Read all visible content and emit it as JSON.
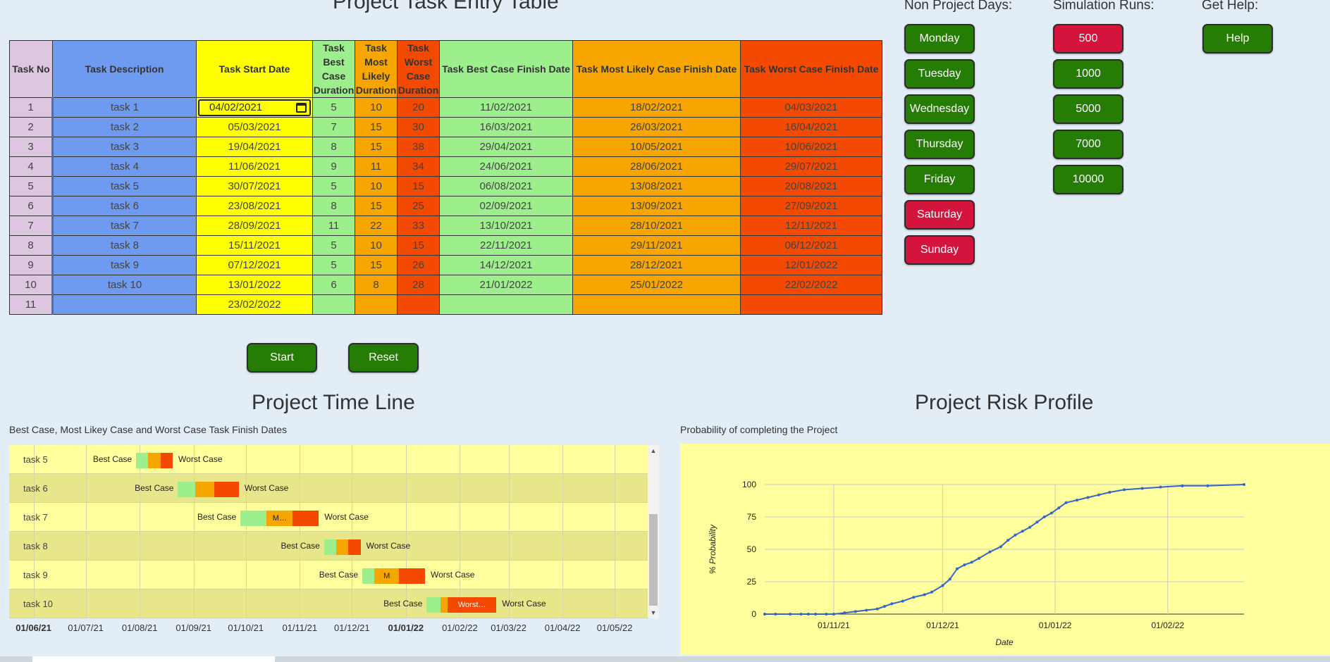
{
  "headings": {
    "entry_table": "Project Task Entry Table",
    "non_project_days": "Non Project Days:",
    "simulation_runs": "Simulation Runs:",
    "get_help": "Get Help:",
    "timeline": "Project Time Line",
    "risk": "Project Risk Profile"
  },
  "table": {
    "headers": {
      "no": "Task No",
      "desc": "Task Description",
      "start": "Task Start Date",
      "best": "Task Best Case Duration",
      "ml": "Task Most Likely Duration",
      "worst": "Task Worst Case Duration",
      "best_finish": "Task Best Case Finish Date",
      "ml_finish": "Task Most Likely Case Finish Date",
      "worst_finish": "Task Worst Case Finish Date"
    },
    "rows": [
      {
        "no": "1",
        "desc": "task 1",
        "start": "04/02/2021",
        "best": "5",
        "ml": "10",
        "worst": "20",
        "best_finish": "11/02/2021",
        "ml_finish": "18/02/2021",
        "worst_finish": "04/03/2021"
      },
      {
        "no": "2",
        "desc": "task 2",
        "start": "05/03/2021",
        "best": "7",
        "ml": "15",
        "worst": "30",
        "best_finish": "16/03/2021",
        "ml_finish": "26/03/2021",
        "worst_finish": "16/04/2021"
      },
      {
        "no": "3",
        "desc": "task 3",
        "start": "19/04/2021",
        "best": "8",
        "ml": "15",
        "worst": "38",
        "best_finish": "29/04/2021",
        "ml_finish": "10/05/2021",
        "worst_finish": "10/06/2021"
      },
      {
        "no": "4",
        "desc": "task 4",
        "start": "11/06/2021",
        "best": "9",
        "ml": "11",
        "worst": "34",
        "best_finish": "24/06/2021",
        "ml_finish": "28/06/2021",
        "worst_finish": "29/07/2021"
      },
      {
        "no": "5",
        "desc": "task 5",
        "start": "30/07/2021",
        "best": "5",
        "ml": "10",
        "worst": "15",
        "best_finish": "06/08/2021",
        "ml_finish": "13/08/2021",
        "worst_finish": "20/08/2021"
      },
      {
        "no": "6",
        "desc": "task 6",
        "start": "23/08/2021",
        "best": "8",
        "ml": "15",
        "worst": "25",
        "best_finish": "02/09/2021",
        "ml_finish": "13/09/2021",
        "worst_finish": "27/09/2021"
      },
      {
        "no": "7",
        "desc": "task 7",
        "start": "28/09/2021",
        "best": "11",
        "ml": "22",
        "worst": "33",
        "best_finish": "13/10/2021",
        "ml_finish": "28/10/2021",
        "worst_finish": "12/11/2021"
      },
      {
        "no": "8",
        "desc": "task 8",
        "start": "15/11/2021",
        "best": "5",
        "ml": "10",
        "worst": "15",
        "best_finish": "22/11/2021",
        "ml_finish": "29/11/2021",
        "worst_finish": "06/12/2021"
      },
      {
        "no": "9",
        "desc": "task 9",
        "start": "07/12/2021",
        "best": "5",
        "ml": "15",
        "worst": "26",
        "best_finish": "14/12/2021",
        "ml_finish": "28/12/2021",
        "worst_finish": "12/01/2022"
      },
      {
        "no": "10",
        "desc": "task 10",
        "start": "13/01/2022",
        "best": "6",
        "ml": "8",
        "worst": "28",
        "best_finish": "21/01/2022",
        "ml_finish": "25/01/2022",
        "worst_finish": "22/02/2022"
      },
      {
        "no": "11",
        "desc": "",
        "start": "23/02/2022",
        "best": "",
        "ml": "",
        "worst": "",
        "best_finish": "",
        "ml_finish": "",
        "worst_finish": ""
      }
    ]
  },
  "buttons": {
    "days": [
      {
        "label": "Monday",
        "selected": true
      },
      {
        "label": "Tuesday",
        "selected": true
      },
      {
        "label": "Wednesday",
        "selected": true
      },
      {
        "label": "Thursday",
        "selected": true
      },
      {
        "label": "Friday",
        "selected": true
      },
      {
        "label": "Saturday",
        "selected": false
      },
      {
        "label": "Sunday",
        "selected": false
      }
    ],
    "runs": [
      {
        "label": "500",
        "selected": false
      },
      {
        "label": "1000",
        "selected": true
      },
      {
        "label": "5000",
        "selected": true
      },
      {
        "label": "7000",
        "selected": true
      },
      {
        "label": "10000",
        "selected": true
      }
    ],
    "help": "Help",
    "start": "Start",
    "reset": "Reset"
  },
  "colors": {
    "selected": "#267d05",
    "unselected": "#d4143c",
    "best": "#9cef8c",
    "most_likely": "#f7a500",
    "worst": "#f44900"
  },
  "timeline": {
    "subtitle": "Best Case, Most Likey Case and Worst Case Task Finish Dates",
    "best_label": "Best Case",
    "worst_label": "Worst Case",
    "rows": [
      {
        "label": "task 5",
        "ml_text": "",
        "worst_text": ""
      },
      {
        "label": "task 6",
        "ml_text": "",
        "worst_text": ""
      },
      {
        "label": "task 7",
        "ml_text": "M…",
        "worst_text": ""
      },
      {
        "label": "task 8",
        "ml_text": "",
        "worst_text": ""
      },
      {
        "label": "task 9",
        "ml_text": "M",
        "worst_text": ""
      },
      {
        "label": "task 10",
        "ml_text": "",
        "worst_text": "Worst…"
      }
    ],
    "ticks": [
      {
        "label": "01/06/21",
        "bold": true
      },
      {
        "label": "01/07/21",
        "bold": false
      },
      {
        "label": "01/08/21",
        "bold": false
      },
      {
        "label": "01/09/21",
        "bold": false
      },
      {
        "label": "01/10/21",
        "bold": false
      },
      {
        "label": "01/11/21",
        "bold": false
      },
      {
        "label": "01/12/21",
        "bold": false
      },
      {
        "label": "01/01/22",
        "bold": true
      },
      {
        "label": "01/02/22",
        "bold": false
      },
      {
        "label": "01/03/22",
        "bold": false
      },
      {
        "label": "01/04/22",
        "bold": false
      },
      {
        "label": "01/05/22",
        "bold": false
      }
    ]
  },
  "chart_data": {
    "type": "line",
    "subtitle": "Probability of completing the Project",
    "xlabel": "Date",
    "ylabel": "% Probability",
    "x_ticks": [
      "01/11/21",
      "01/12/21",
      "01/01/22",
      "01/02/22"
    ],
    "y_ticks": [
      0,
      25,
      50,
      75,
      100
    ],
    "ylim": [
      0,
      100
    ],
    "xlim": [
      "2021-10-13",
      "2022-02-22"
    ],
    "grid": true,
    "legend": "none",
    "series": [
      {
        "color": "#3366cc",
        "points": [
          [
            "2021-10-13",
            0
          ],
          [
            "2021-10-16",
            0
          ],
          [
            "2021-10-20",
            0
          ],
          [
            "2021-10-23",
            0
          ],
          [
            "2021-10-25",
            0
          ],
          [
            "2021-10-27",
            0
          ],
          [
            "2021-10-30",
            0
          ],
          [
            "2021-11-01",
            0
          ],
          [
            "2021-11-04",
            1
          ],
          [
            "2021-11-07",
            2
          ],
          [
            "2021-11-10",
            3
          ],
          [
            "2021-11-13",
            4
          ],
          [
            "2021-11-15",
            6
          ],
          [
            "2021-11-17",
            8
          ],
          [
            "2021-11-20",
            10
          ],
          [
            "2021-11-23",
            13
          ],
          [
            "2021-11-26",
            15
          ],
          [
            "2021-11-28",
            17
          ],
          [
            "2021-12-01",
            22
          ],
          [
            "2021-12-03",
            27
          ],
          [
            "2021-12-05",
            35
          ],
          [
            "2021-12-07",
            38
          ],
          [
            "2021-12-09",
            40
          ],
          [
            "2021-12-11",
            43
          ],
          [
            "2021-12-14",
            48
          ],
          [
            "2021-12-17",
            52
          ],
          [
            "2021-12-19",
            57
          ],
          [
            "2021-12-21",
            61
          ],
          [
            "2021-12-23",
            64
          ],
          [
            "2021-12-25",
            67
          ],
          [
            "2021-12-27",
            71
          ],
          [
            "2021-12-29",
            75
          ],
          [
            "2021-12-31",
            78
          ],
          [
            "2022-01-02",
            82
          ],
          [
            "2022-01-04",
            86
          ],
          [
            "2022-01-07",
            88
          ],
          [
            "2022-01-10",
            90
          ],
          [
            "2022-01-13",
            92
          ],
          [
            "2022-01-16",
            94
          ],
          [
            "2022-01-20",
            96
          ],
          [
            "2022-01-25",
            97
          ],
          [
            "2022-01-30",
            98
          ],
          [
            "2022-02-05",
            99
          ],
          [
            "2022-02-12",
            99
          ],
          [
            "2022-02-22",
            100
          ]
        ]
      }
    ]
  },
  "timeline_chart_data": {
    "type": "bar",
    "xlim": [
      "2021-05-18",
      "2022-05-20"
    ],
    "rows": [
      {
        "task": "task 5",
        "start": "2021-07-30",
        "best_finish": "2021-08-06",
        "ml_finish": "2021-08-13",
        "worst_finish": "2021-08-20"
      },
      {
        "task": "task 6",
        "start": "2021-08-23",
        "best_finish": "2021-09-02",
        "ml_finish": "2021-09-13",
        "worst_finish": "2021-09-27"
      },
      {
        "task": "task 7",
        "start": "2021-09-28",
        "best_finish": "2021-10-13",
        "ml_finish": "2021-10-28",
        "worst_finish": "2021-11-12"
      },
      {
        "task": "task 8",
        "start": "2021-11-15",
        "best_finish": "2021-11-22",
        "ml_finish": "2021-11-29",
        "worst_finish": "2021-12-06"
      },
      {
        "task": "task 9",
        "start": "2021-12-07",
        "best_finish": "2021-12-14",
        "ml_finish": "2021-12-28",
        "worst_finish": "2022-01-12"
      },
      {
        "task": "task 10",
        "start": "2022-01-13",
        "best_finish": "2022-01-21",
        "ml_finish": "2022-01-25",
        "worst_finish": "2022-02-22"
      }
    ]
  }
}
